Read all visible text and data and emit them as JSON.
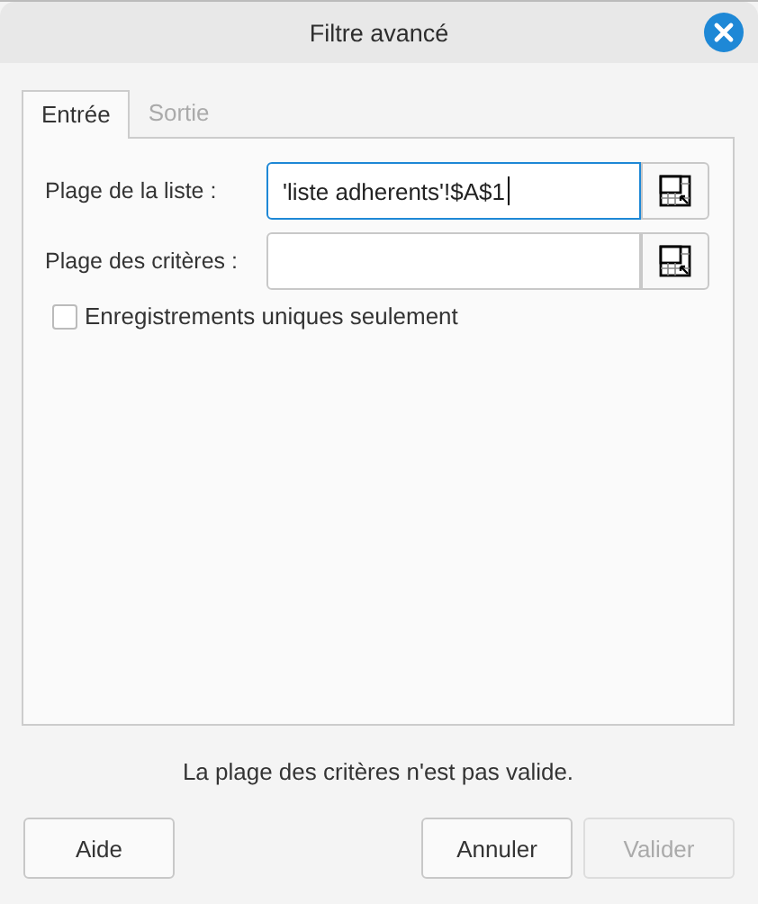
{
  "window": {
    "title": "Filtre avancé"
  },
  "tabs": [
    {
      "label": "Entrée",
      "selected": true
    },
    {
      "label": "Sortie",
      "selected": false
    }
  ],
  "fields": [
    {
      "label": "Plage de la liste :",
      "value": "'liste adherents'!$A$1",
      "focused": true
    },
    {
      "label": "Plage des critères :",
      "focused": false
    }
  ],
  "checkbox": {
    "label": "Enregistrements uniques seulement",
    "checked": false
  },
  "message": "La plage des critères n'est pas valide.",
  "buttons": [
    {
      "label": "Aide",
      "disabled": false
    },
    {
      "label": "Annuler",
      "disabled": false
    },
    {
      "label": "Valider",
      "disabled": true
    }
  ]
}
